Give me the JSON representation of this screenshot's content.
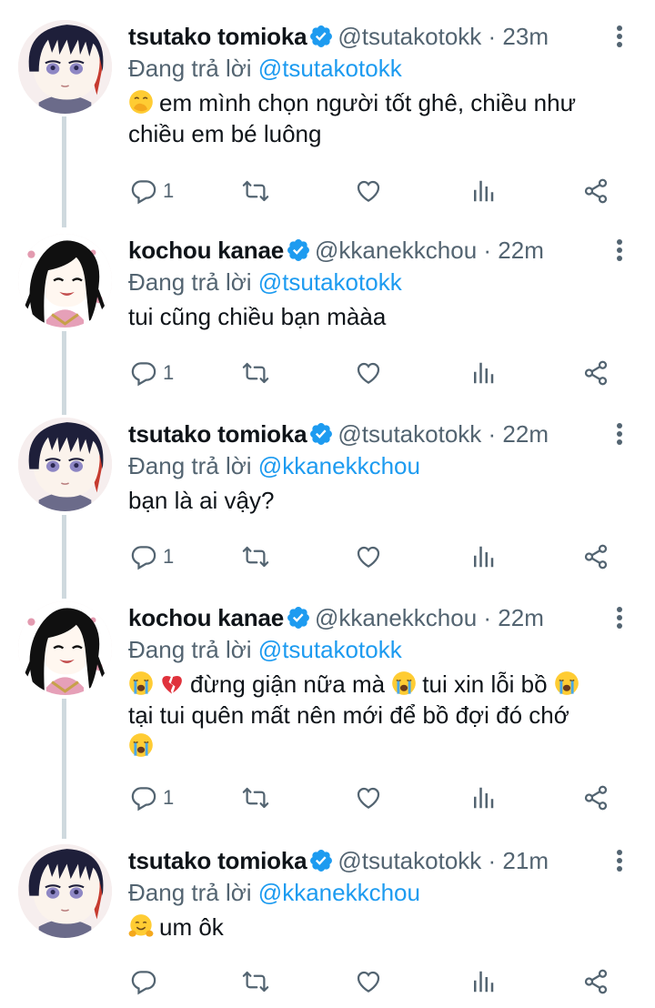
{
  "replying_label": "Đang trả lời",
  "colors": {
    "accent": "#1d9bf0",
    "secondary": "#536471",
    "thread_line": "#cfd9de"
  },
  "tweets": [
    {
      "name": "tsutako tomioka",
      "handle": "@tsutakotokk",
      "dot": "·",
      "time": "23m",
      "replying_to": "@tsutakotokk",
      "emoji": "hand-over-mouth-emoji",
      "text_lines": [
        "em mình chọn người tốt ghê, chiều như",
        "chiều em bé luông"
      ],
      "reply_count": "1",
      "avatar": "tsutako-avatar"
    },
    {
      "name": "kochou kanae",
      "handle": "@kkanekkchou",
      "dot": "·",
      "time": "22m",
      "replying_to": "@tsutakotokk",
      "text_lines": [
        "tui cũng chiều bạn mààa"
      ],
      "reply_count": "1",
      "avatar": "kanae-avatar"
    },
    {
      "name": "tsutako tomioka",
      "handle": "@tsutakotokk",
      "dot": "·",
      "time": "22m",
      "replying_to": "@kkanekkchou",
      "text_lines": [
        "bạn là ai vậy?"
      ],
      "reply_count": "1",
      "avatar": "tsutako-avatar"
    },
    {
      "name": "kochou kanae",
      "handle": "@kkanekkchou",
      "dot": "·",
      "time": "22m",
      "replying_to": "@tsutakotokk",
      "text_parts": [
        "đừng giận nữa mà",
        "tui xin lỗi bồ",
        "tại tui quên mất nên mới để bồ đợi đó chớ"
      ],
      "reply_count": "1",
      "avatar": "kanae-avatar"
    },
    {
      "name": "tsutako tomioka",
      "handle": "@tsutakotokk",
      "dot": "·",
      "time": "21m",
      "replying_to": "@kkanekkchou",
      "emoji": "hugging-face-emoji",
      "text_lines": [
        "um ôk"
      ],
      "reply_count": "",
      "avatar": "tsutako-avatar"
    }
  ]
}
